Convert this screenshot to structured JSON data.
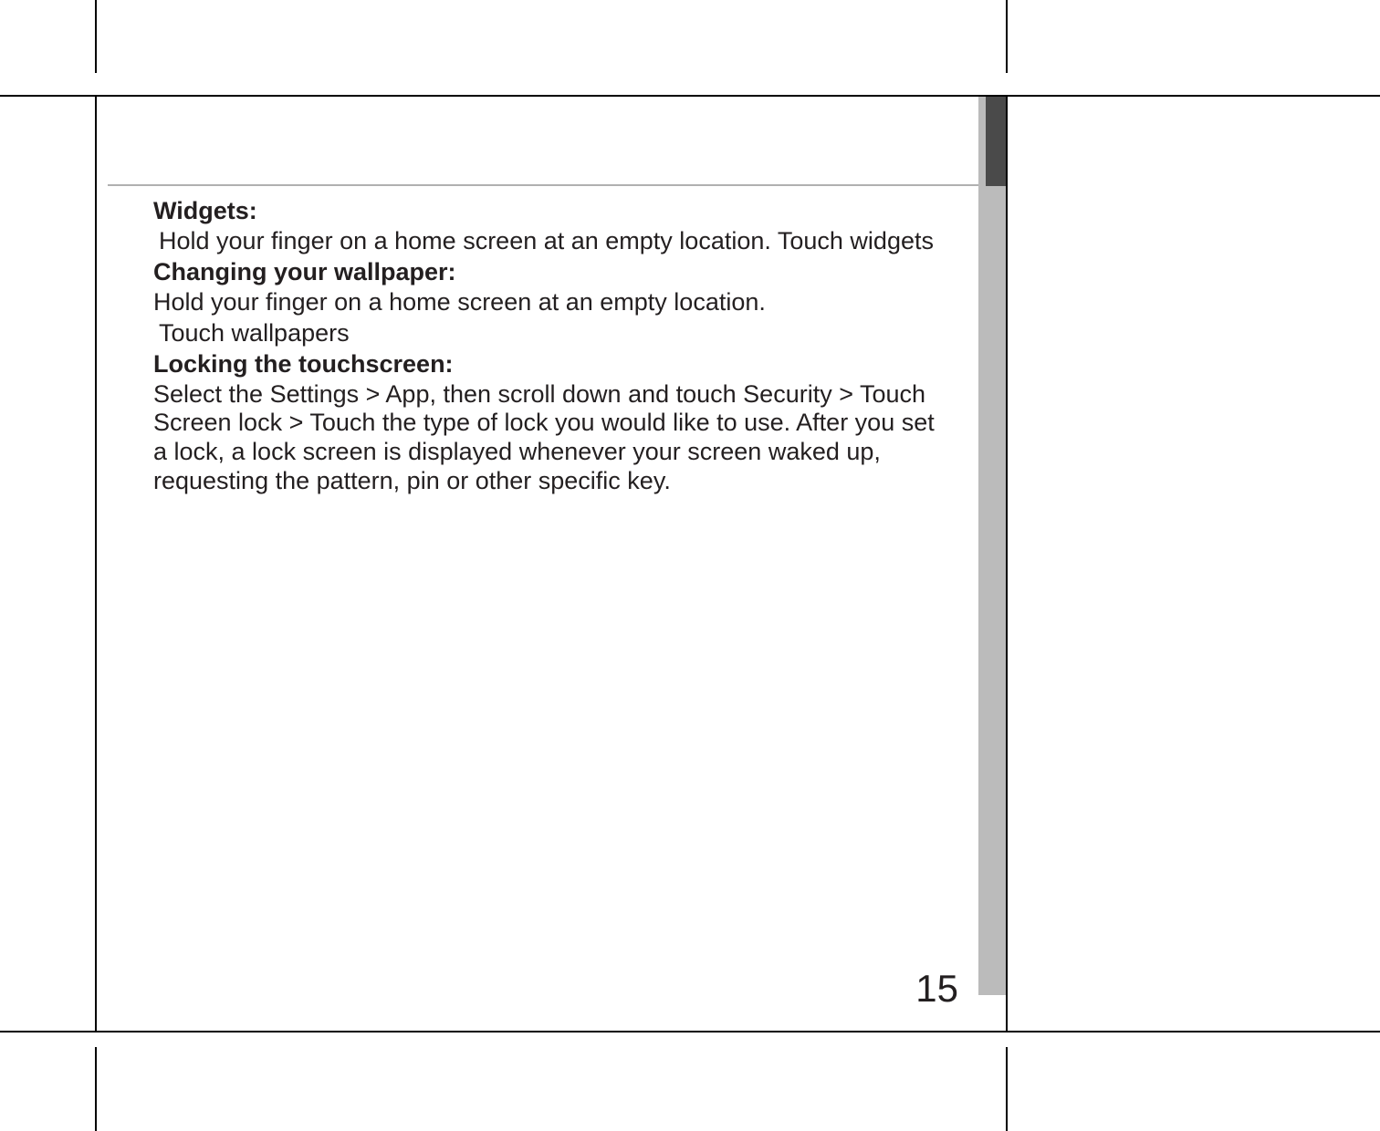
{
  "sidebar_label": "",
  "sections": {
    "widgets": {
      "heading": "Widgets:",
      "body": "Hold your finger on a home screen at an empty location. Touch widgets"
    },
    "wallpaper": {
      "heading": "Changing your wallpaper:",
      "body1": "Hold your finger on a home screen at an empty location.",
      "body2": "Touch wallpapers"
    },
    "lock": {
      "heading": "Locking the touchscreen:",
      "body": "Select the Settings > App, then scroll down and touch Security > Touch Screen lock > Touch the type of lock you would like to use. After you set  a lock, a lock screen is displayed whenever your screen waked up, requesting the pattern, pin or other specific key."
    }
  },
  "page_number": "15"
}
